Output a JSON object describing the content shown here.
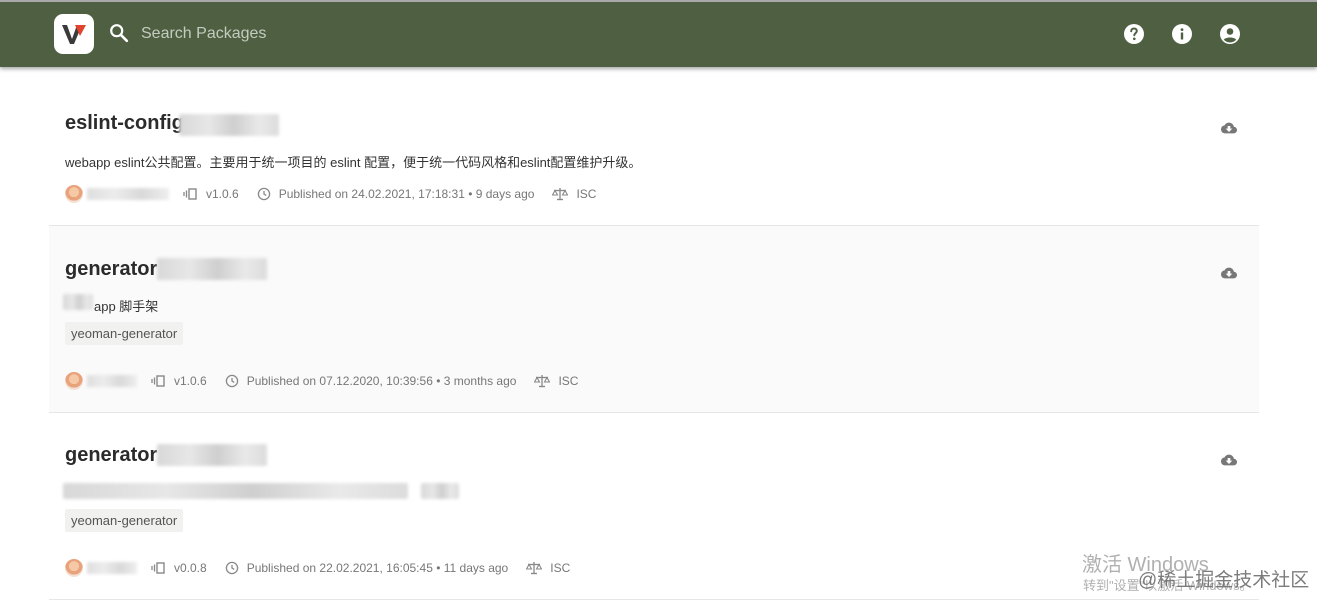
{
  "header": {
    "search_placeholder": "Search Packages",
    "icons": [
      "help-icon",
      "info-icon",
      "account-icon"
    ],
    "bar_color": "#4e6041"
  },
  "packages": [
    {
      "name": "eslint-config",
      "description": "webapp eslint公共配置。主要用于统一项目的 eslint 配置，便于统一代码风格和eslint配置维护升级。",
      "keyword": "",
      "version": "v1.0.6",
      "published": "Published on 24.02.2021, 17:18:31 • 9 days ago",
      "license": "ISC"
    },
    {
      "name": "generator",
      "description": "app 脚手架",
      "keyword": "yeoman-generator",
      "version": "v1.0.6",
      "published": "Published on 07.12.2020, 10:39:56 • 3 months ago",
      "license": "ISC"
    },
    {
      "name": "generator",
      "description": "",
      "keyword": "yeoman-generator",
      "version": "v0.0.8",
      "published": "Published on 22.02.2021, 16:05:45 • 11 days ago",
      "license": "ISC"
    }
  ],
  "overlay": {
    "activate_title": "激活 Windows",
    "activate_sub": "转到\"设置\"以激活 Windows。",
    "juejin": "@稀土掘金技术社区"
  }
}
